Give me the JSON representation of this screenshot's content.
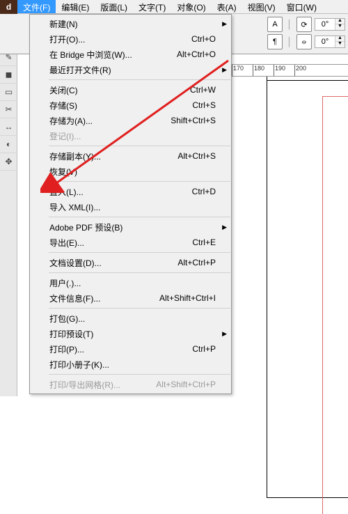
{
  "app_corner": "d",
  "menubar": {
    "items": [
      {
        "label": "文件(F)",
        "active": true
      },
      {
        "label": "编辑(E)"
      },
      {
        "label": "版面(L)"
      },
      {
        "label": "文字(T)"
      },
      {
        "label": "对象(O)"
      },
      {
        "label": "表(A)"
      },
      {
        "label": "视图(V)"
      },
      {
        "label": "窗口(W)"
      }
    ]
  },
  "toolbar": {
    "angle1": "0°",
    "angle2": "0°"
  },
  "ruler": {
    "ticks": [
      "170",
      "180",
      "190",
      "200"
    ]
  },
  "dropdown": [
    {
      "type": "item",
      "label": "新建(N)",
      "submenu": true
    },
    {
      "type": "item",
      "label": "打开(O)...",
      "shortcut": "Ctrl+O"
    },
    {
      "type": "item",
      "label": "在 Bridge 中浏览(W)...",
      "shortcut": "Alt+Ctrl+O"
    },
    {
      "type": "item",
      "label": "最近打开文件(R)",
      "submenu": true
    },
    {
      "type": "sep"
    },
    {
      "type": "item",
      "label": "关闭(C)",
      "shortcut": "Ctrl+W"
    },
    {
      "type": "item",
      "label": "存储(S)",
      "shortcut": "Ctrl+S"
    },
    {
      "type": "item",
      "label": "存储为(A)...",
      "shortcut": "Shift+Ctrl+S"
    },
    {
      "type": "item",
      "label": "登记(I)...",
      "disabled": true
    },
    {
      "type": "sep"
    },
    {
      "type": "item",
      "label": "存储副本(Y)...",
      "shortcut": "Alt+Ctrl+S"
    },
    {
      "type": "item",
      "label": "恢复(V)"
    },
    {
      "type": "sep"
    },
    {
      "type": "item",
      "label": "置入(L)...",
      "shortcut": "Ctrl+D"
    },
    {
      "type": "item",
      "label": "导入 XML(I)..."
    },
    {
      "type": "sep"
    },
    {
      "type": "item",
      "label": "Adobe PDF 预设(B)",
      "submenu": true
    },
    {
      "type": "item",
      "label": "导出(E)...",
      "shortcut": "Ctrl+E"
    },
    {
      "type": "sep"
    },
    {
      "type": "item",
      "label": "文档设置(D)...",
      "shortcut": "Alt+Ctrl+P"
    },
    {
      "type": "sep"
    },
    {
      "type": "item",
      "label": "用户(.)..."
    },
    {
      "type": "item",
      "label": "文件信息(F)...",
      "shortcut": "Alt+Shift+Ctrl+I"
    },
    {
      "type": "sep"
    },
    {
      "type": "item",
      "label": "打包(G)..."
    },
    {
      "type": "item",
      "label": "打印预设(T)",
      "submenu": true
    },
    {
      "type": "item",
      "label": "打印(P)...",
      "shortcut": "Ctrl+P"
    },
    {
      "type": "item",
      "label": "打印小册子(K)..."
    },
    {
      "type": "sep"
    },
    {
      "type": "item",
      "label": "打印/导出网格(R)...",
      "shortcut": "Alt+Shift+Ctrl+P",
      "disabled": true
    }
  ]
}
